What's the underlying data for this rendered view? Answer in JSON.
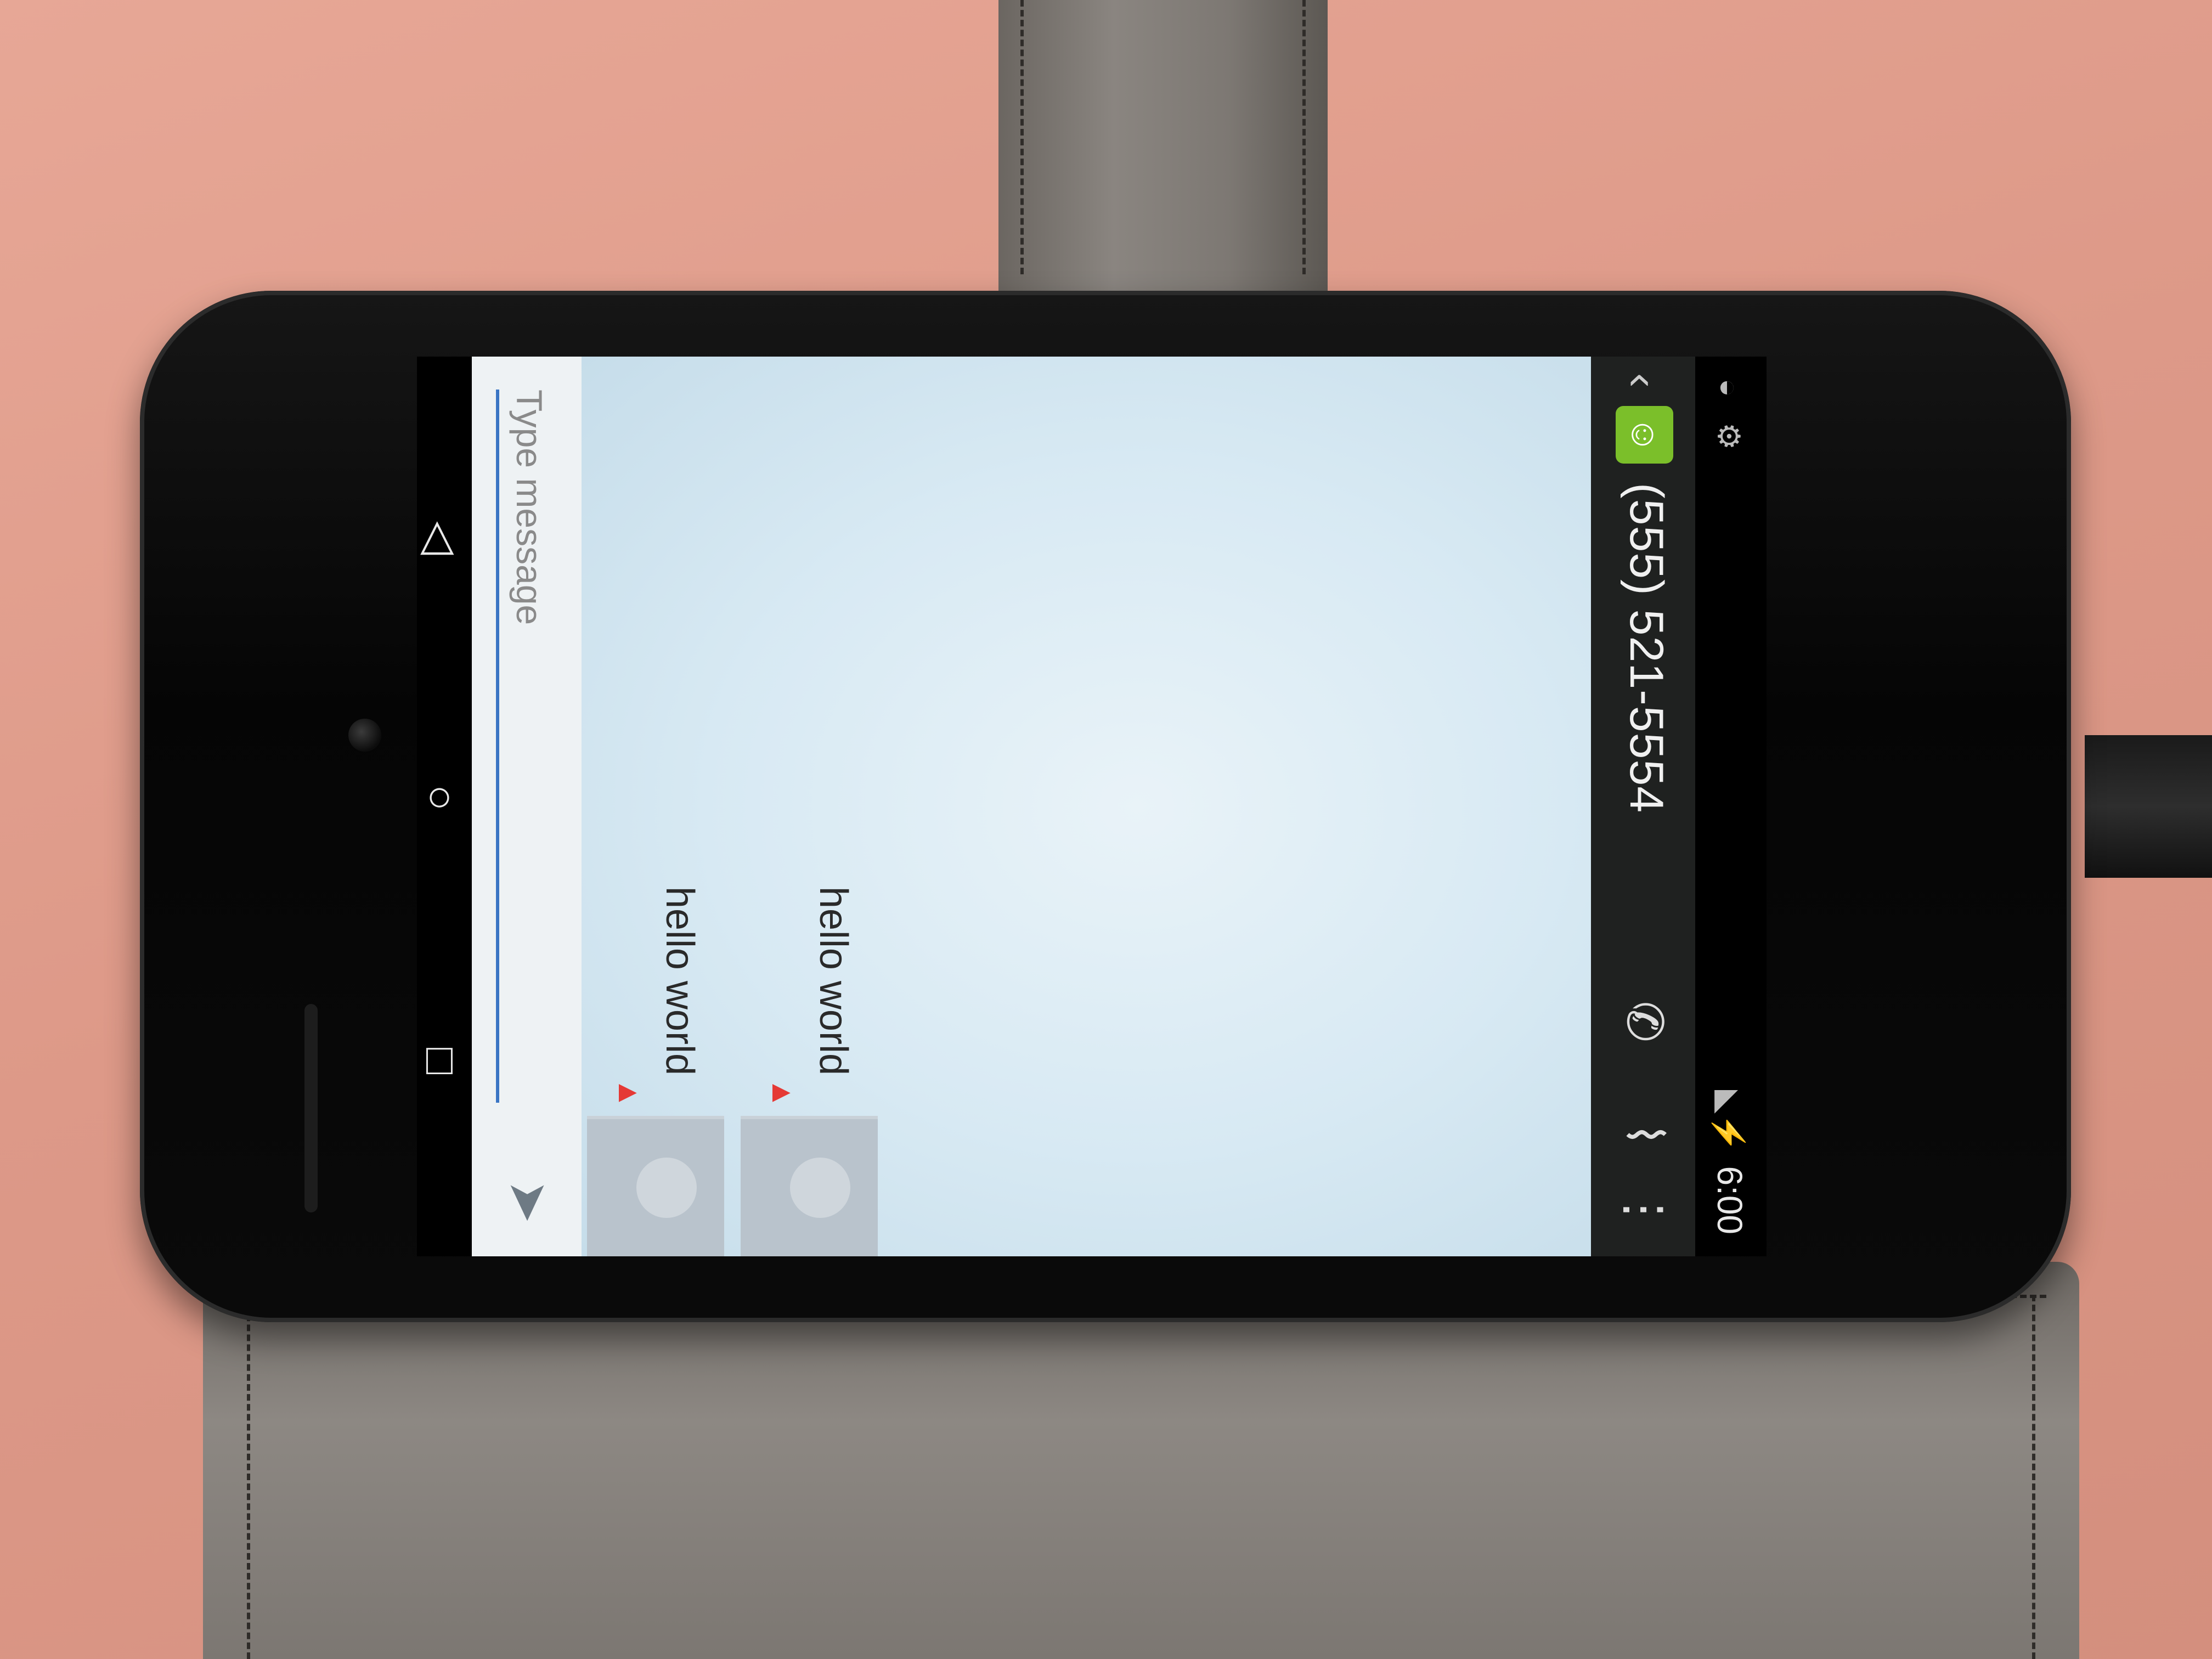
{
  "status_bar": {
    "time": "6:00"
  },
  "action_bar": {
    "back_glyph": "‹",
    "app_icon": "messaging-app-icon",
    "title": "(555) 521-5554",
    "call_icon": "phone-icon",
    "attach_icon": "paperclip-icon",
    "overflow_icon": "overflow-menu-icon"
  },
  "messages": [
    {
      "text": "hello world",
      "status": "failed"
    },
    {
      "text": "hello world",
      "status": "failed"
    }
  ],
  "compose": {
    "placeholder": "Type message",
    "send_icon": "send-icon"
  },
  "nav_bar": {
    "back": "back-icon",
    "home": "home-icon",
    "recents": "recents-icon"
  },
  "colors": {
    "accent": "#3a75c4",
    "error": "#e53935",
    "app_icon": "#7bbf2a"
  }
}
